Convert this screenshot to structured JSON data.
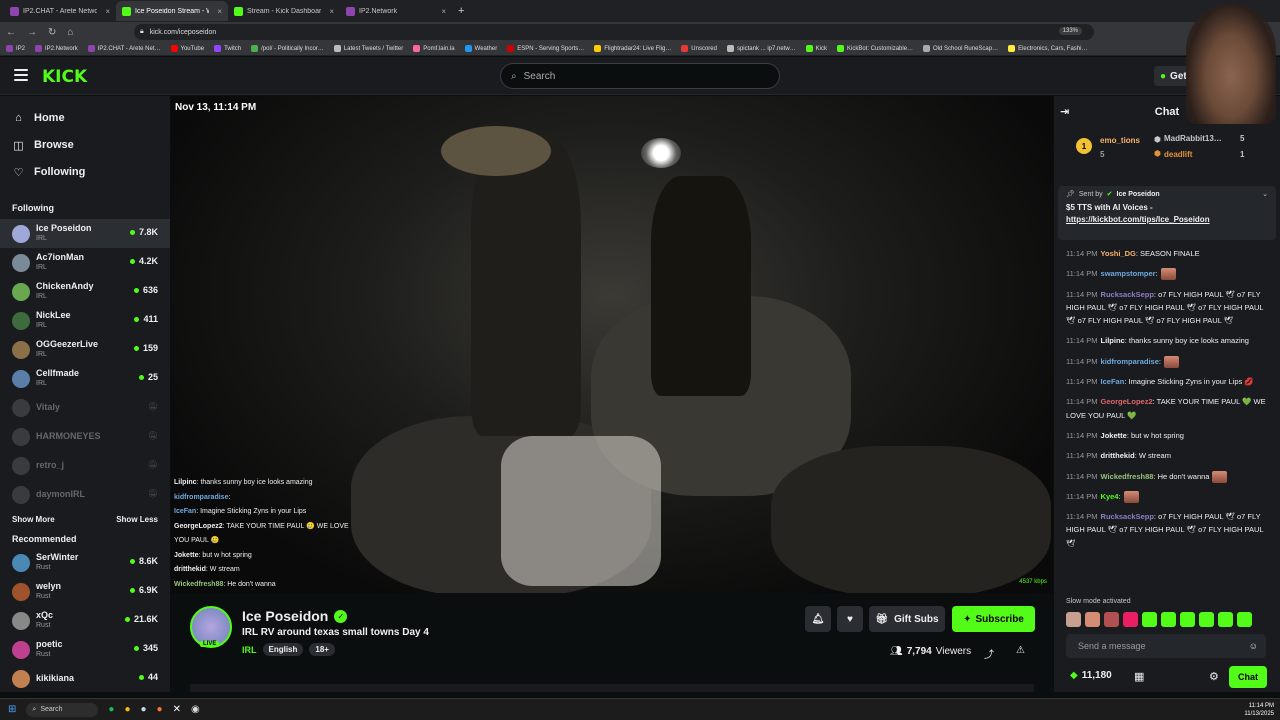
{
  "browser": {
    "tabs": [
      {
        "title": "IP2.CHAT - Arete Network",
        "color": "#8e44ad",
        "active": false
      },
      {
        "title": "Ice Poseidon Stream - Wat…",
        "color": "#53fc18",
        "active": true
      },
      {
        "title": "Stream - Kick Dashboard",
        "color": "#53fc18",
        "active": false
      },
      {
        "title": "IP2.Network",
        "color": "#8e44ad",
        "active": false
      }
    ],
    "url": "kick.com/iceposeidon",
    "zoom": "133%",
    "bookmarks": [
      "IP2",
      "IP2.Network",
      "IP2.CHAT - Arete Net…",
      "YouTube",
      "Twitch",
      "/pol/ - Politically Incor…",
      "Latest Tweets / Twitter",
      "Pomf.lain.la",
      "Weather",
      "ESPN - Serving Sports…",
      "Flightradar24: Live Flig…",
      "Unscored",
      "spictank ... ip7.netw…",
      "Kick",
      "KickBot: Customizable…",
      "Old School RuneScap…",
      "Electronics, Cars, Fashi…"
    ]
  },
  "header": {
    "logo": "KICK",
    "search_placeholder": "Search",
    "get_label": "Get"
  },
  "sidebar": {
    "nav": [
      {
        "label": "Home",
        "icon": "home-icon",
        "glyph": "⌂"
      },
      {
        "label": "Browse",
        "icon": "browse-icon",
        "glyph": "◫"
      },
      {
        "label": "Following",
        "icon": "heart-icon",
        "glyph": "♡"
      }
    ],
    "following_title": "Following",
    "following": [
      {
        "name": "Ice Poseidon",
        "category": "IRL",
        "viewers": "7.8K",
        "color": "#9fa8d8"
      },
      {
        "name": "Ac7ionMan",
        "category": "IRL",
        "viewers": "4.2K",
        "color": "#7a8a99"
      },
      {
        "name": "ChickenAndy",
        "category": "IRL",
        "viewers": "636",
        "color": "#6aa84f"
      },
      {
        "name": "NickLee",
        "category": "IRL",
        "viewers": "411",
        "color": "#3d6b3d"
      },
      {
        "name": "OGGeezerLive",
        "category": "IRL",
        "viewers": "159",
        "color": "#8b6f47"
      },
      {
        "name": "Cellfmade",
        "category": "IRL",
        "viewers": "25",
        "color": "#5a7ea8"
      }
    ],
    "offline": [
      "Vitaly",
      "HARMONEYES",
      "retro_j",
      "daymonIRL"
    ],
    "show_more": "Show More",
    "show_less": "Show Less",
    "recommended_title": "Recommended",
    "recommended": [
      {
        "name": "SerWinter",
        "category": "Rust",
        "viewers": "8.6K",
        "color": "#4a88b5"
      },
      {
        "name": "welyn",
        "category": "Rust",
        "viewers": "6.9K",
        "color": "#a0522d"
      },
      {
        "name": "xQc",
        "category": "Rust",
        "viewers": "21.6K",
        "color": "#888888"
      },
      {
        "name": "poetic",
        "category": "Rust",
        "viewers": "345",
        "color": "#c04090"
      },
      {
        "name": "kikikiana",
        "category": "",
        "viewers": "44",
        "color": "#c08050"
      }
    ]
  },
  "video": {
    "timestamp": "Nov 13, 11:14 PM",
    "kbps": "4537 kbps",
    "overlay_chat": [
      {
        "user": "Lilpinc",
        "text": ": thanks sunny boy ice looks amazing",
        "color": "#efeff1"
      },
      {
        "user": "kidfromparadise",
        "text": ":",
        "color": "#6fa8dc"
      },
      {
        "user": "IceFan",
        "text": ": Imagine Sticking Zyns in your Lips",
        "color": "#6fa8dc"
      },
      {
        "user": "GeorgeLopez2",
        "text": ": TAKE YOUR TIME PAUL 🥲 WE LOVE",
        "color": "#efeff1"
      },
      {
        "user": "",
        "text": "YOU PAUL 🥲",
        "color": "#efeff1"
      },
      {
        "user": "Jokette",
        "text": ": but w hot spring",
        "color": "#efeff1"
      },
      {
        "user": "dritthekid",
        "text": ": W stream",
        "color": "#efeff1"
      },
      {
        "user": "Wickedfresh88",
        "text": ": He don't wanna",
        "color": "#93c47d"
      }
    ]
  },
  "stream": {
    "name": "Ice Poseidon",
    "title": "IRL RV around texas small towns Day 4",
    "category": "IRL",
    "tags": [
      "English",
      "18+"
    ],
    "live": "LIVE",
    "viewers": "7,794",
    "viewers_label": "Viewers",
    "gift_label": "Gift Subs",
    "subscribe_label": "Subscribe"
  },
  "chat": {
    "title": "Chat",
    "leaderboard": [
      {
        "rank": "1",
        "user": "emo_tions",
        "points": "5"
      },
      {
        "user": "MadRabbit13…",
        "points": "5"
      },
      {
        "user": "deadlift",
        "points": "1"
      }
    ],
    "pinned": {
      "sent_by": "Sent by",
      "author": "Ice Poseidon",
      "text": "$5 TTS with AI Voices - ",
      "link": "https://kickbot.com/tips/Ice_Poseidon"
    },
    "messages": [
      {
        "time": "11:14 PM",
        "user": "Yoshi_DG",
        "color": "#f6b26b",
        "text": ": SEASON FINALE"
      },
      {
        "time": "11:14 PM",
        "user": "swampstomper",
        "color": "#6fa8dc",
        "text": ":",
        "emote": true
      },
      {
        "time": "11:14 PM",
        "user": "RucksackSepp",
        "color": "#8e7cc3",
        "text": ": o7 FLY HIGH PAUL 🕊 o7 FLY HIGH PAUL 🕊 o7 FLY HIGH PAUL 🕊 o7 FLY HIGH PAUL 🕊 o7 FLY HIGH PAUL 🕊 o7 FLY HIGH PAUL 🕊"
      },
      {
        "time": "11:14 PM",
        "user": "Lilpinc",
        "color": "#efeff1",
        "text": ": thanks sunny boy ice looks amazing"
      },
      {
        "time": "11:14 PM",
        "user": "kidfromparadise",
        "color": "#6fa8dc",
        "text": ":",
        "emote": true
      },
      {
        "time": "11:14 PM",
        "user": "IceFan",
        "color": "#6fa8dc",
        "text": ": Imagine Sticking Zyns in your Lips 💋"
      },
      {
        "time": "11:14 PM",
        "user": "GeorgeLopez2",
        "color": "#e06666",
        "text": ": TAKE YOUR TIME PAUL 💚 WE LOVE YOU PAUL 💚"
      },
      {
        "time": "11:14 PM",
        "user": "Jokette",
        "color": "#efeff1",
        "text": ": but w hot spring"
      },
      {
        "time": "11:14 PM",
        "user": "dritthekid",
        "color": "#efeff1",
        "text": ": W stream"
      },
      {
        "time": "11:14 PM",
        "user": "Wickedfresh88",
        "color": "#93c47d",
        "text": ": He don't wanna",
        "emote": true
      },
      {
        "time": "11:14 PM",
        "user": "Kye4",
        "color": "#53fc18",
        "text": ":",
        "emote": true
      },
      {
        "time": "11:14 PM",
        "user": "RucksackSepp",
        "color": "#8e7cc3",
        "text": ": o7 FLY HIGH PAUL 🕊 o7 FLY HIGH PAUL 🕊 o7 FLY HIGH PAUL 🕊 o7 FLY HIGH PAUL 🕊"
      }
    ],
    "slow_mode": "Slow mode activated",
    "input_placeholder": "Send a message",
    "points": "11,180",
    "send_label": "Chat"
  },
  "taskbar": {
    "search": "Search",
    "time": "11:14 PM",
    "date": "11/13/2025"
  },
  "colors": {
    "brand": "#53fc18",
    "bg": "#0b0e0f",
    "panel": "#191b1f"
  }
}
